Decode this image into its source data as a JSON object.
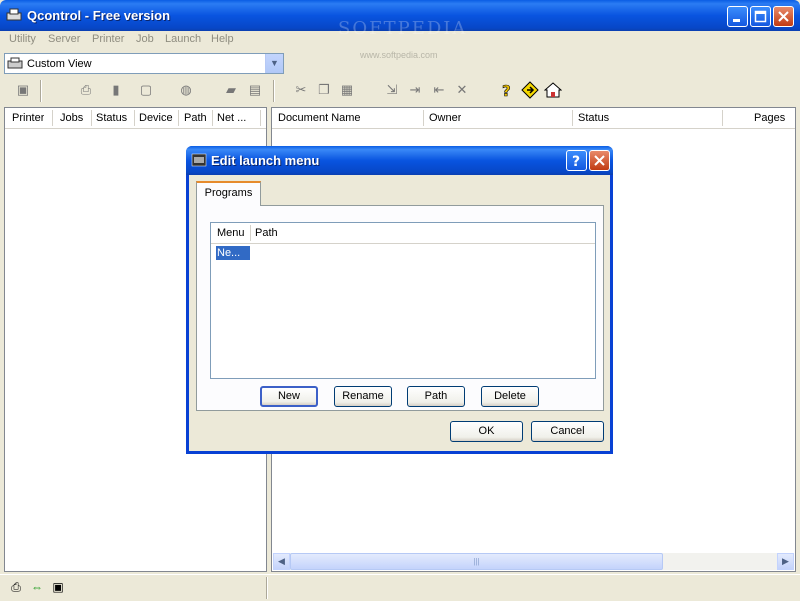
{
  "app": {
    "title": "Qcontrol - Free version",
    "watermark": "SOFTPEDIA",
    "watermark_url": "www.softpedia.com",
    "accent": "#0a5de4"
  },
  "menubar": {
    "items": [
      "Utility",
      "Server",
      "Printer",
      "Job",
      "Launch",
      "Help"
    ]
  },
  "view_selector": {
    "value": "Custom View"
  },
  "toolbar": {
    "icons": [
      "properties-icon",
      "printer-icon",
      "device-icon",
      "frame-icon",
      "bin-icon",
      "open-folder-icon",
      "save-icon",
      "cut-icon",
      "copy-icon",
      "paste-icon",
      "job-move-icon",
      "job-forward-icon",
      "job-back-icon",
      "delete-icon",
      "help-icon",
      "warning-icon",
      "home-icon"
    ]
  },
  "left_pane": {
    "columns": [
      "Printer",
      "Jobs",
      "Status",
      "Device",
      "Path",
      "Net ..."
    ]
  },
  "right_pane": {
    "columns": [
      "Document Name",
      "Owner",
      "Status",
      "Pages"
    ]
  },
  "dialog": {
    "title": "Edit launch menu",
    "tab_label": "Programs",
    "list_columns": [
      "Menu",
      "Path"
    ],
    "list_items": [
      {
        "menu": "Ne...",
        "path": ""
      }
    ],
    "buttons": {
      "new": "New",
      "rename": "Rename",
      "path": "Path",
      "delete": "Delete",
      "ok": "OK",
      "cancel": "Cancel"
    }
  }
}
